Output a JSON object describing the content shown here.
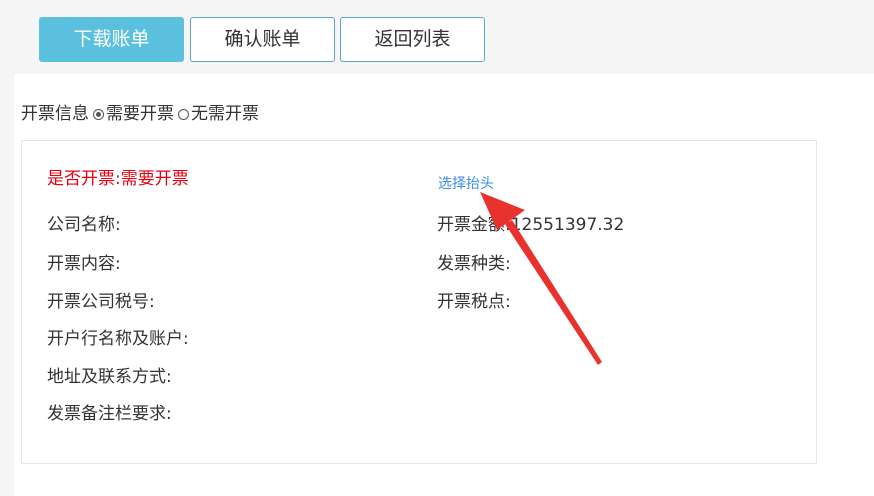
{
  "toolbar": {
    "download_label": "下载账单",
    "confirm_label": "确认账单",
    "back_label": "返回列表"
  },
  "invoice": {
    "label": "开票信息",
    "option_need": "需要开票",
    "option_no_need": "无需开票",
    "selected": "需要开票"
  },
  "panel": {
    "status_text": "是否开票:需要开票",
    "choose_header_link": "选择抬头",
    "company_name_label": "公司名称:",
    "content_label": "开票内容:",
    "tax_id_label": "开票公司税号:",
    "bank_label": "开户行名称及账户:",
    "address_label": "地址及联系方式:",
    "remark_label": "发票备注栏要求:",
    "amount_label": "开票金额:",
    "amount_value": "12551397.32",
    "type_label": "发票种类:",
    "tax_rate_label": "开票税点:"
  },
  "colors": {
    "primary": "#5bc0de",
    "status_red": "#e60012",
    "link_blue": "#3a8ee6",
    "arrow_red": "#e8322e"
  }
}
